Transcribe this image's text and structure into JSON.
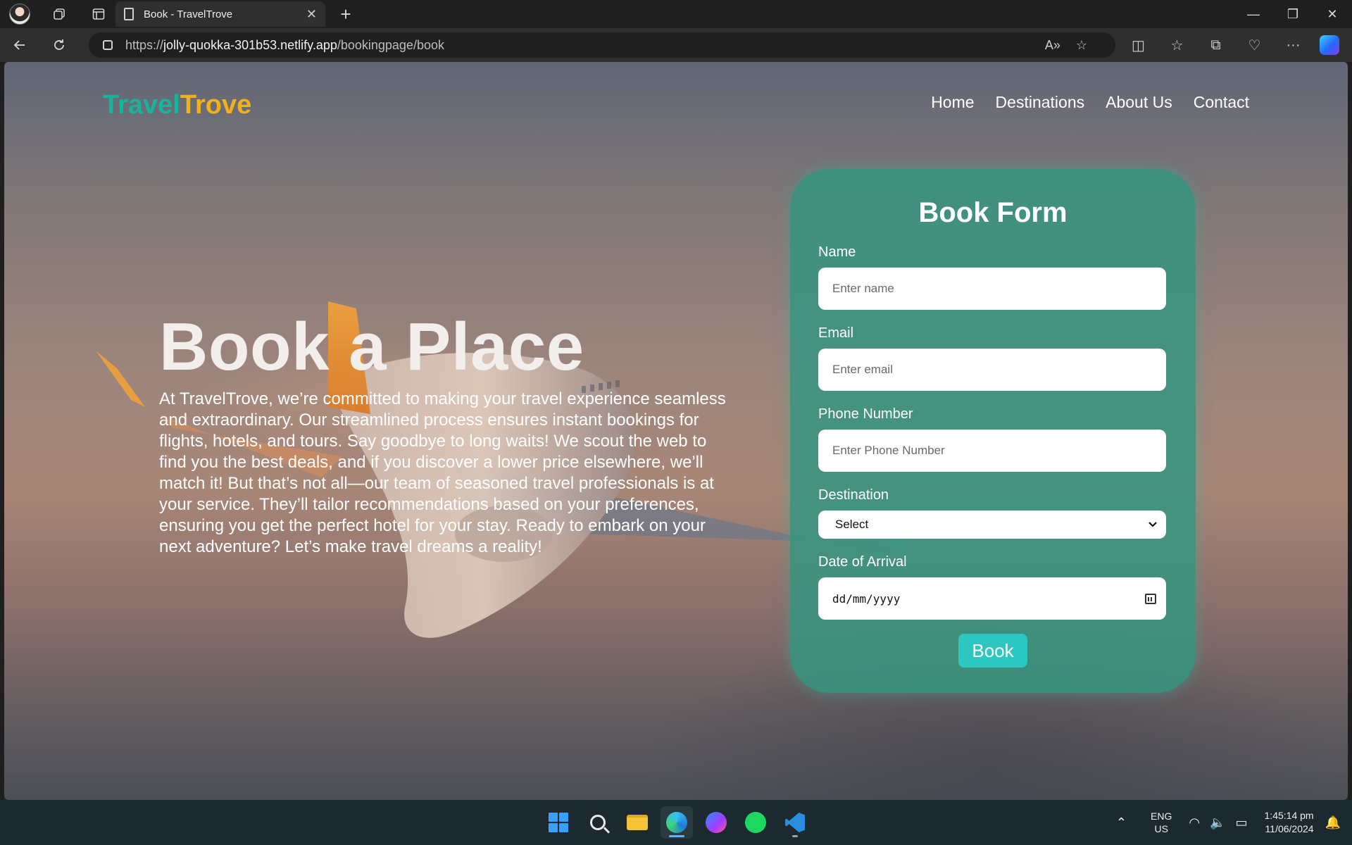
{
  "browser": {
    "tab_title": "Book - TravelTrove",
    "url_prefix": "https://",
    "url_host": "jolly-quokka-301b53.netlify.app",
    "url_path": "/bookingpage/book"
  },
  "site": {
    "brand_part1": "Travel",
    "brand_part2": "Trove",
    "nav": [
      "Home",
      "Destinations",
      "About Us",
      "Contact"
    ]
  },
  "hero": {
    "title": "Book a Place",
    "text": "At TravelTrove, we’re committed to making your travel experience seamless and extraordinary. Our streamlined process ensures instant bookings for flights, hotels, and tours. Say goodbye to long waits! We scout the web to find you the best deals, and if you discover a lower price elsewhere, we’ll match it! But that’s not all—our team of seasoned travel professionals is at your service. They’ll tailor recommendations based on your preferences, ensuring you get the perfect hotel for your stay. Ready to embark on your next adventure? Let’s make travel dreams a reality!"
  },
  "form": {
    "title": "Book Form",
    "name_label": "Name",
    "name_placeholder": "Enter name",
    "email_label": "Email",
    "email_placeholder": "Enter email",
    "phone_label": "Phone Number",
    "phone_placeholder": "Enter Phone Number",
    "destination_label": "Destination",
    "destination_selected": "Select",
    "date_label": "Date of Arrival",
    "date_placeholder": "dd/mm/yyyy",
    "submit_label": "Book"
  },
  "taskbar": {
    "lang_line1": "ENG",
    "lang_line2": "US",
    "time": "1:45:14 pm",
    "date": "11/06/2024"
  },
  "colors": {
    "brand_green": "#17b39b",
    "brand_yellow": "#f0b11a",
    "form_bg": "#389480",
    "button_bg": "#2cc7c0"
  }
}
